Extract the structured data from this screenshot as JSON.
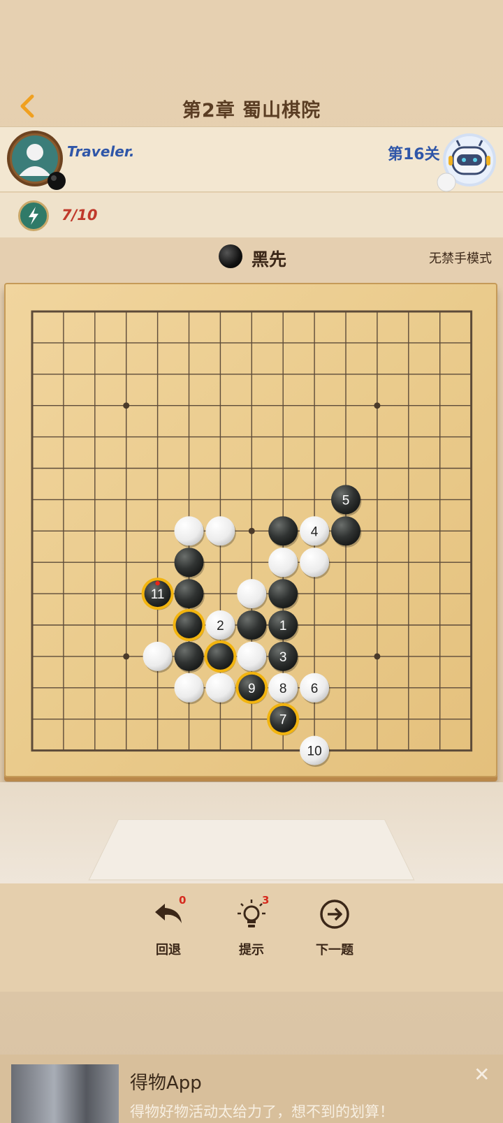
{
  "header": {
    "title": "第2章 蜀山棋院"
  },
  "player": {
    "name": "Traveler.",
    "stone": "black"
  },
  "opponent": {
    "level_label": "第16关",
    "stone": "white"
  },
  "energy": {
    "value": "7/10"
  },
  "turn": {
    "label": "黑先"
  },
  "mode": {
    "label": "无禁手模式"
  },
  "board": {
    "size": 15,
    "star_points": [
      [
        3,
        3
      ],
      [
        11,
        3
      ],
      [
        7,
        7
      ],
      [
        3,
        11
      ],
      [
        11,
        11
      ]
    ],
    "stones": [
      {
        "color": "black",
        "col": 10,
        "row": 6,
        "label": "5"
      },
      {
        "color": "white",
        "col": 5,
        "row": 7,
        "label": ""
      },
      {
        "color": "white",
        "col": 6,
        "row": 7,
        "label": ""
      },
      {
        "color": "black",
        "col": 8,
        "row": 7,
        "label": ""
      },
      {
        "color": "white",
        "col": 9,
        "row": 7,
        "label": "4"
      },
      {
        "color": "black",
        "col": 10,
        "row": 7,
        "label": ""
      },
      {
        "color": "black",
        "col": 5,
        "row": 8,
        "label": ""
      },
      {
        "color": "white",
        "col": 8,
        "row": 8,
        "label": ""
      },
      {
        "color": "white",
        "col": 9,
        "row": 8,
        "label": ""
      },
      {
        "color": "black",
        "col": 4,
        "row": 9,
        "label": "11",
        "highlight": true,
        "last": true
      },
      {
        "color": "black",
        "col": 5,
        "row": 9,
        "label": ""
      },
      {
        "color": "white",
        "col": 7,
        "row": 9,
        "label": ""
      },
      {
        "color": "black",
        "col": 8,
        "row": 9,
        "label": ""
      },
      {
        "color": "black",
        "col": 5,
        "row": 10,
        "label": "",
        "highlight": true
      },
      {
        "color": "white",
        "col": 6,
        "row": 10,
        "label": "2"
      },
      {
        "color": "black",
        "col": 7,
        "row": 10,
        "label": ""
      },
      {
        "color": "black",
        "col": 8,
        "row": 10,
        "label": "1"
      },
      {
        "color": "white",
        "col": 4,
        "row": 11,
        "label": ""
      },
      {
        "color": "black",
        "col": 5,
        "row": 11,
        "label": ""
      },
      {
        "color": "black",
        "col": 6,
        "row": 11,
        "label": "",
        "highlight": true
      },
      {
        "color": "white",
        "col": 7,
        "row": 11,
        "label": ""
      },
      {
        "color": "black",
        "col": 8,
        "row": 11,
        "label": "3"
      },
      {
        "color": "white",
        "col": 5,
        "row": 12,
        "label": ""
      },
      {
        "color": "white",
        "col": 6,
        "row": 12,
        "label": ""
      },
      {
        "color": "black",
        "col": 7,
        "row": 12,
        "label": "9",
        "highlight": true
      },
      {
        "color": "white",
        "col": 8,
        "row": 12,
        "label": "8"
      },
      {
        "color": "white",
        "col": 9,
        "row": 12,
        "label": "6"
      },
      {
        "color": "black",
        "col": 8,
        "row": 13,
        "label": "7",
        "highlight": true
      },
      {
        "color": "white",
        "col": 9,
        "row": 14,
        "label": "10"
      }
    ]
  },
  "toolbar": {
    "undo": {
      "label": "回退",
      "count": "0"
    },
    "hint": {
      "label": "提示",
      "count": "3"
    },
    "next": {
      "label": "下一题"
    }
  },
  "ad": {
    "title": "得物App",
    "subtitle": "得物好物活动太给力了，想不到的划算！",
    "close": "✕"
  },
  "colors": {
    "accent_blue": "#2f56a8",
    "highlight_ring": "#f2b40f",
    "badge_red": "#d62a1e"
  }
}
